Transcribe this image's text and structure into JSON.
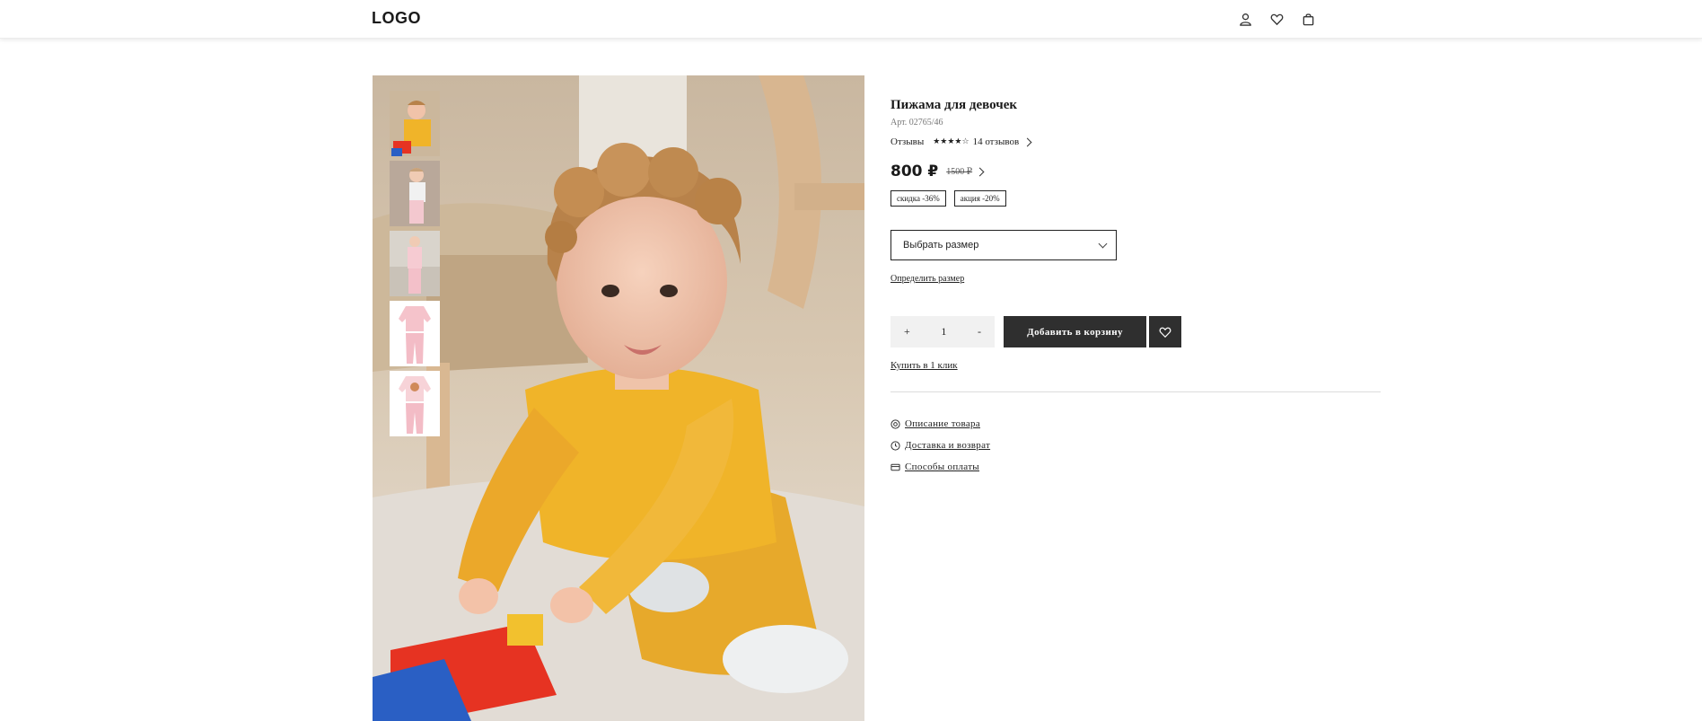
{
  "header": {
    "logo": "LOGO",
    "icons": [
      "user-icon",
      "heart-icon",
      "bag-icon"
    ]
  },
  "gallery": {
    "main_image": "Ребёнок в жёлтой пижаме играет с игрушечной машинкой",
    "thumbnails": 5
  },
  "product": {
    "title": "Пижама для девочек",
    "sku": "Арт. 02765/46",
    "reviews_label": "Отзывы",
    "stars": "★★★★☆",
    "rating": 4,
    "reviews_count": "14 отзывов",
    "price": "800 ₽",
    "old_price": "1500 ₽",
    "badges": [
      "скидка -36%",
      "акция -20%"
    ],
    "size_select": "Выбрать размер",
    "size_link": "Определить размер",
    "qty_plus": "+",
    "qty_value": "1",
    "qty_minus": "-",
    "add_to_cart": "Добавить в корзину",
    "one_click": "Купить в 1 клик",
    "links": {
      "description": "Описание товара",
      "delivery": "Доставка и возврат",
      "payment": "Способы оплаты"
    }
  },
  "colors": {
    "accent": "#2f2f2f",
    "shirt": "#f0b429"
  }
}
